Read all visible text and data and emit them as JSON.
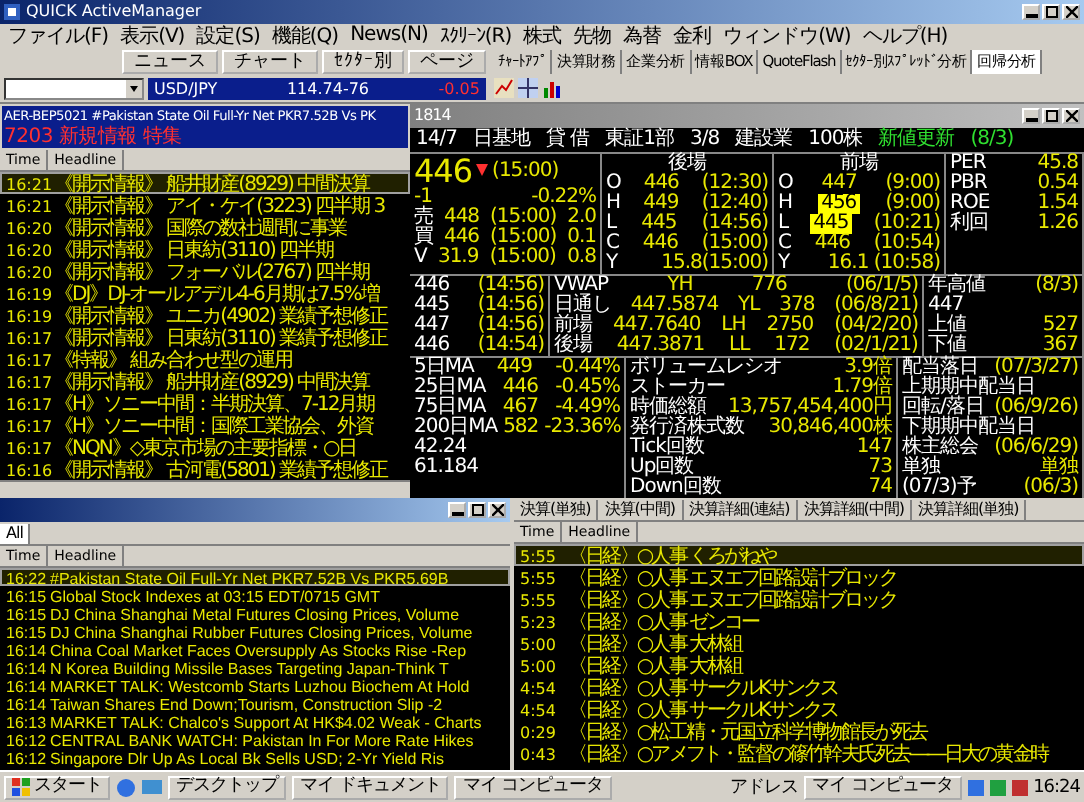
{
  "window": {
    "title": "QUICK ActiveManager"
  },
  "menu": [
    "ファイル(F)",
    "表示(V)",
    "設定(S)",
    "機能(Q)",
    "News(N)",
    "ｽｸﾘｰﾝ(R)",
    "株式",
    "先物",
    "為替",
    "金利",
    "ウィンドウ(W)",
    "ヘルプ(H)"
  ],
  "toolbar": {
    "buttons": [
      "ニュース",
      "チャート",
      "ｾｸﾀｰ別",
      "ページ"
    ],
    "ticker": {
      "symbol": "USD/JPY",
      "value": "114.74-76",
      "change": "-0.05"
    },
    "tools": [
      {
        "label": "ﾁｬｰﾄｱﾌﾟ",
        "selected": false
      },
      {
        "label": "決算財務",
        "selected": false
      },
      {
        "label": "企業分析",
        "selected": false
      },
      {
        "label": "情報BOX",
        "selected": false
      },
      {
        "label": "QuoteFlash",
        "selected": false
      },
      {
        "label": "ｾｸﾀｰ別ｽﾌﾟﾚｯﾄﾞ分析",
        "selected": false
      },
      {
        "label": "回帰分析",
        "selected": true
      }
    ]
  },
  "flash": [
    {
      "text": "AER-BEP5021 #Pakistan State Oil Full-Yr Net PKR7.52B Vs PK",
      "kind": "news"
    },
    {
      "text": "7203  新規情報  特集",
      "kind": "alert"
    }
  ],
  "news_top": {
    "columns": [
      "Time",
      "Headline"
    ],
    "rows": [
      {
        "time": "16:21",
        "headline": "《開示情報》 船井財産(8929) 中間決算",
        "selected": true
      },
      {
        "time": "16:21",
        "headline": "《開示情報》 アイ・ケイ(3223) 四半期 3",
        "selected": false
      },
      {
        "time": "16:20",
        "headline": "《開示情報》 国際の数社週間に事業",
        "selected": false
      },
      {
        "time": "16:20",
        "headline": "《開示情報》 日東紡(3110) 四半期",
        "selected": false
      },
      {
        "time": "16:20",
        "headline": "《開示情報》 フォーバル(2767) 四半期",
        "selected": false
      },
      {
        "time": "16:19",
        "headline": "《DJ》DJ-オールアデル4-6月期は7.5%増",
        "selected": false
      },
      {
        "time": "16:19",
        "headline": "《開示情報》 ユニカ(4902) 業績予想修正",
        "selected": false
      },
      {
        "time": "16:17",
        "headline": "《開示情報》 日東紡(3110) 業績予想修正",
        "selected": false
      },
      {
        "time": "16:17",
        "headline": "《特報》 組み合わせ型の運用",
        "selected": false
      },
      {
        "time": "16:17",
        "headline": "《開示情報》 船井財産(8929) 中間決算",
        "selected": false
      },
      {
        "time": "16:17",
        "headline": "《H》ソニー中間：半期決算、7-12月期",
        "selected": false
      },
      {
        "time": "16:17",
        "headline": "《H》ソニー中間：国際工業協会、外資",
        "selected": false
      },
      {
        "time": "16:17",
        "headline": "《NQN》◇東京市場の主要指標・○日",
        "selected": false
      },
      {
        "time": "16:16",
        "headline": "《開示情報》 古河電(5801) 業績予想修正",
        "selected": false
      }
    ]
  },
  "quote": {
    "title": "1814",
    "header": [
      "14/7",
      "日基地",
      "貸 借",
      "東証1部",
      "3/8",
      "建設業",
      "100株"
    ],
    "flag": "新値更新",
    "flag_date": "(8/3)",
    "price": {
      "last": "446",
      "change": "-1",
      "pct": "-0.22%",
      "time": "(15:00)",
      "lines": [
        [
          "売",
          "448",
          "(15:00)",
          "2.0"
        ],
        [
          "買",
          "446",
          "(15:00)",
          "0.1"
        ],
        [
          "V",
          "31.9",
          "(15:00)",
          "0.8"
        ]
      ]
    },
    "sessions": [
      {
        "title": "後場",
        "rows": [
          {
            "label": "O",
            "price": "446",
            "time": "(12:30)",
            "highlight": false
          },
          {
            "label": "H",
            "price": "449",
            "time": "(12:40)",
            "highlight": false
          },
          {
            "label": "L",
            "price": "445",
            "time": "(14:56)",
            "highlight": false
          },
          {
            "label": "C",
            "price": "446",
            "time": "(15:00)",
            "highlight": false
          }
        ],
        "footer": [
          "Y",
          "15.8(15:00)"
        ]
      },
      {
        "title": "前場",
        "rows": [
          {
            "label": "O",
            "price": "447",
            "time": "(9:00)",
            "highlight": false
          },
          {
            "label": "H",
            "price": "456",
            "time": "(9:00)",
            "highlight": true
          },
          {
            "label": "L",
            "price": "445",
            "time": "(10:21)",
            "highlight": true
          },
          {
            "label": "C",
            "price": "446",
            "time": "(10:54)",
            "highlight": false
          }
        ],
        "footer": [
          "Y",
          "16.1 (10:58)"
        ]
      }
    ],
    "ratios": [
      [
        "PER",
        "45.8"
      ],
      [
        "PBR",
        "0.54"
      ],
      [
        "ROE",
        "1.54"
      ],
      [
        "利回",
        "1.26"
      ]
    ],
    "ticks": [
      [
        "446",
        "(14:56)"
      ],
      [
        "445",
        "(14:56)"
      ],
      [
        "447",
        "(14:56)"
      ],
      [
        "446",
        "(14:54)"
      ]
    ],
    "vwap": [
      [
        "VWAP",
        "YH",
        "776",
        "(06/1/5)"
      ],
      [
        "日通し",
        "447.5874",
        "YL",
        "378",
        "(06/8/21)"
      ],
      [
        "前場",
        "447.7640",
        "LH",
        "2750",
        "(04/2/20)"
      ],
      [
        "後場",
        "447.3871",
        "LL",
        "172",
        "(02/1/21)"
      ]
    ],
    "range": [
      [
        "年高値",
        "(8/3)"
      ],
      [
        "447"
      ],
      [
        "上値",
        "527"
      ],
      [
        "下値",
        "367"
      ]
    ],
    "averages": [
      [
        "5日MA",
        "449",
        "-0.44%"
      ],
      [
        "25日MA",
        "446",
        "-0.45%"
      ],
      [
        "75日MA",
        "467",
        "-4.49%"
      ],
      [
        "200日MA",
        "582",
        "-23.36%"
      ],
      [
        "42.24"
      ],
      [
        "61.184"
      ]
    ],
    "stats": [
      [
        "ボリュームレシオ",
        "3.9倍"
      ],
      [
        "ストーカー",
        "1.79倍"
      ],
      [
        "時価総額",
        "13,757,454,400円"
      ],
      [
        "発行済株式数",
        "30,846,400株"
      ],
      [
        "Tick回数",
        "147"
      ],
      [
        "Up回数",
        "73"
      ],
      [
        "Down回数",
        "74"
      ]
    ],
    "dates": [
      [
        "配当落日",
        "(07/3/27)"
      ],
      [
        "上期期中配当日"
      ],
      [
        "回転/落日",
        "(06/9/26)"
      ],
      [
        "下期期中配当日"
      ],
      [
        "株主総会",
        "(06/6/29)"
      ],
      [
        "単独",
        "単独"
      ],
      [
        "(07/3)予",
        "(06/3)"
      ]
    ]
  },
  "news_en": {
    "tab": "All",
    "columns": [
      "Time",
      "Headline"
    ],
    "rows": [
      {
        "time": "16:22",
        "headline": "#Pakistan State Oil Full-Yr Net PKR7.52B Vs PKR5.69B",
        "selected": true
      },
      {
        "time": "16:15",
        "headline": "Global Stock Indexes at 03:15 EDT/0715 GMT",
        "selected": false
      },
      {
        "time": "16:15",
        "headline": "DJ China Shanghai Metal Futures Closing Prices, Volume",
        "selected": false
      },
      {
        "time": "16:15",
        "headline": "DJ China Shanghai Rubber Futures Closing Prices, Volume",
        "selected": false
      },
      {
        "time": "16:14",
        "headline": "China Coal Market Faces Oversupply As Stocks Rise -Rep",
        "selected": false
      },
      {
        "time": "16:14",
        "headline": "N Korea Building Missile Bases Targeting Japan-Think T",
        "selected": false
      },
      {
        "time": "16:14",
        "headline": "MARKET TALK: Westcomb Starts Luzhou Biochem At Hold",
        "selected": false
      },
      {
        "time": "16:14",
        "headline": "Taiwan Shares End Down;Tourism, Construction Slip -2",
        "selected": false
      },
      {
        "time": "16:13",
        "headline": "MARKET TALK: Chalco's Support At HK$4.02 Weak - Charts",
        "selected": false
      },
      {
        "time": "16:12",
        "headline": "CENTRAL BANK WATCH: Pakistan In For More Rate Hikes",
        "selected": false
      },
      {
        "time": "16:12",
        "headline": "Singapore Dlr Up As Local Bk Sells USD; 2-Yr Yield Ris",
        "selected": false
      }
    ]
  },
  "news_jp": {
    "tabs": [
      {
        "label": "決算(単独)",
        "selected": false
      },
      {
        "label": "決算(中間)",
        "selected": false
      },
      {
        "label": "決算詳細(連結)",
        "selected": false
      },
      {
        "label": "決算詳細(中間)",
        "selected": false
      },
      {
        "label": "決算詳細(単独)",
        "selected": false
      }
    ],
    "columns": [
      "Time",
      "Headline"
    ],
    "rows": [
      {
        "time": "5:55",
        "headline": "〈日経〉○人事 くろがねや",
        "selected": true
      },
      {
        "time": "5:55",
        "headline": "〈日経〉○人事 エヌエフ回路設計ブロック",
        "selected": false
      },
      {
        "time": "5:55",
        "headline": "〈日経〉○人事 エヌエフ回路設計ブロック",
        "selected": false
      },
      {
        "time": "5:23",
        "headline": "〈日経〉○人事 ゼンコー",
        "selected": false
      },
      {
        "time": "5:00",
        "headline": "〈日経〉○人事 大林組",
        "selected": false
      },
      {
        "time": "5:00",
        "headline": "〈日経〉○人事 大林組",
        "selected": false
      },
      {
        "time": "4:54",
        "headline": "〈日経〉○人事 サークルKサンクス",
        "selected": false
      },
      {
        "time": "4:54",
        "headline": "〈日経〉○人事 サークルKサンクス",
        "selected": false
      },
      {
        "time": "0:29",
        "headline": "〈日経〉○松工精・元国立科学博物館長が死去",
        "selected": false
      },
      {
        "time": "0:43",
        "headline": "〈日経〉○アメフト・監督の篠竹幹夫氏死去――日大の黄金時",
        "selected": false
      }
    ]
  },
  "taskbar": {
    "start": "スタート",
    "items": [
      "デスクトップ",
      "マイ ドキュメント",
      "マイ コンピュータ"
    ],
    "address": "アドレス",
    "address_value": "マイ コンピュータ",
    "clock": "16:24"
  }
}
